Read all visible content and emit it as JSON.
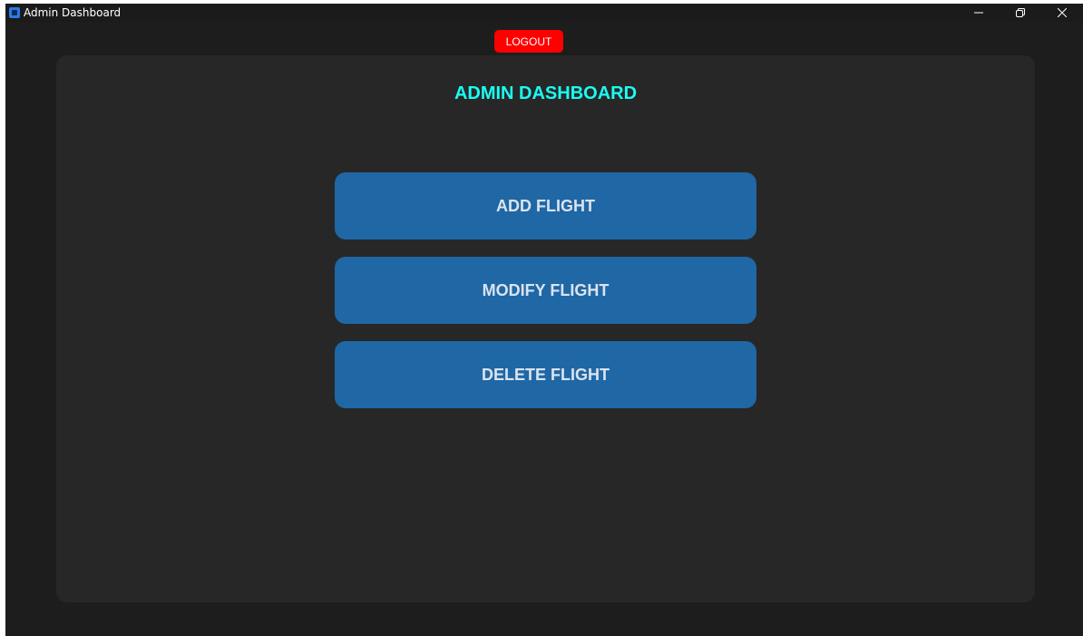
{
  "window": {
    "title": "Admin Dashboard",
    "icon": "app-window-icon",
    "controls": [
      "minimize-icon",
      "restore-icon",
      "close-icon"
    ]
  },
  "header": {
    "logout_label": "LOGOUT"
  },
  "main": {
    "title": "ADMIN DASHBOARD",
    "actions": [
      {
        "label": "ADD FLIGHT"
      },
      {
        "label": "MODIFY FLIGHT"
      },
      {
        "label": "DELETE FLIGHT"
      }
    ]
  },
  "colors": {
    "background": "#1d1d1d",
    "panel": "#272727",
    "title_accent": "#1bfcf2",
    "action_button": "#1f67a5",
    "action_text": "#dce3ee",
    "logout_button": "#ff0000"
  }
}
